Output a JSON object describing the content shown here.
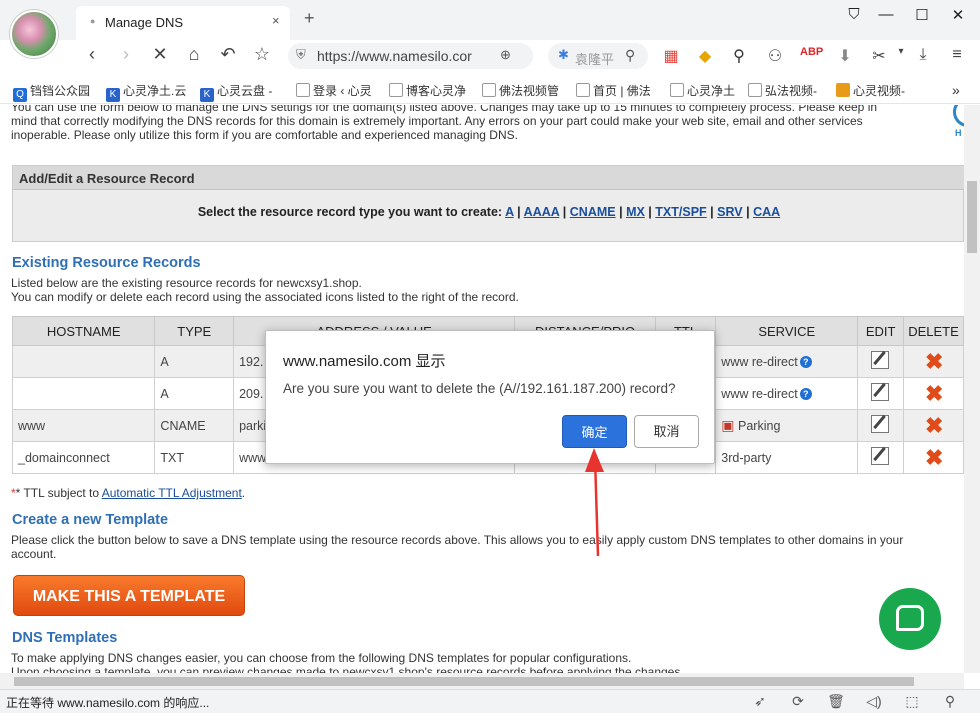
{
  "browser": {
    "tab_title": "Manage DNS",
    "tab_close": "×",
    "new_tab": "+",
    "url": "https://www.namesilo.cor",
    "search_placeholder": "袁隆平",
    "bookmarks": [
      "铛铛公众园",
      "心灵净土.云",
      "心灵云盘 -",
      "登录 ‹ 心灵",
      "博客心灵净",
      "佛法视频管",
      "首页 | 佛法",
      "心灵净土",
      "弘法视频-",
      "心灵视频-"
    ],
    "bookmarks_more": "»",
    "status_text": "正在等待 www.namesilo.com 的响应..."
  },
  "page": {
    "intro_line1": "You can use the form below to manage the DNS settings for the domain(s) listed above. Changes may take up to 15 minutes to completely process. Please keep in",
    "intro_line2": "mind that correctly modifying the DNS records for this domain is extremely important. Any errors on your part could make your web site, email and other services",
    "intro_line3": "inoperable. Please only utilize this form if you are comfortable and experienced managing DNS.",
    "add_edit_title": "Add/Edit a Resource Record",
    "select_prompt": "Select the resource record type you want to create:",
    "record_types": [
      "A",
      "AAAA",
      "CNAME",
      "MX",
      "TXT/SPF",
      "SRV",
      "CAA"
    ],
    "existing_title": "Existing Resource Records",
    "existing_desc1": "Listed below are the existing resource records for newcxsy1.shop.",
    "existing_desc2": "You can modify or delete each record using the associated icons listed to the right of the record.",
    "table_headers": [
      "HOSTNAME",
      "TYPE",
      "ADDRESS / VALUE",
      "DISTANCE/PRIO",
      "TTL",
      "SERVICE",
      "EDIT",
      "DELETE"
    ],
    "rows": [
      {
        "hostname": "",
        "type": "A",
        "address": "192.",
        "service": "www re-direct",
        "help": true
      },
      {
        "hostname": "",
        "type": "A",
        "address": "209.",
        "service": "www re-direct",
        "help": true
      },
      {
        "hostname": "www",
        "type": "CNAME",
        "address": "parki",
        "service": "Parking",
        "help": false
      },
      {
        "hostname": "_domainconnect",
        "type": "TXT",
        "address": "www",
        "service": "3rd-party",
        "help": false
      }
    ],
    "ttl_note_prefix": "* TTL subject to ",
    "ttl_note_link": "Automatic TTL Adjustment",
    "ttl_note_suffix": ".",
    "template_title": "Create a new Template",
    "template_desc": "Please click the button below to save a DNS template using the resource records above. This allows you to easily apply custom DNS templates to other domains in your",
    "template_desc2": "account.",
    "template_button": "MAKE THIS A TEMPLATE",
    "dns_templates_title": "DNS Templates",
    "dns_templates_desc1": "To make applying DNS changes easier, you can choose from the following DNS templates for popular configurations.",
    "dns_templates_desc2": "Upon choosing a template, you can preview changes made to newcxsy1.shop's resource records before applying the changes."
  },
  "dialog": {
    "title": "www.namesilo.com 显示",
    "message": "Are you sure you want to delete the (A//192.161.187.200) record?",
    "ok_label": "确定",
    "cancel_label": "取消"
  },
  "colors": {
    "link": "#1a4d9c",
    "heading": "#2f6fb6",
    "delete": "#e04b1a",
    "ok_button": "#2b72dc",
    "template_button": "#f0621d",
    "chat": "#1aa84f",
    "arrow": "#e8342f"
  }
}
